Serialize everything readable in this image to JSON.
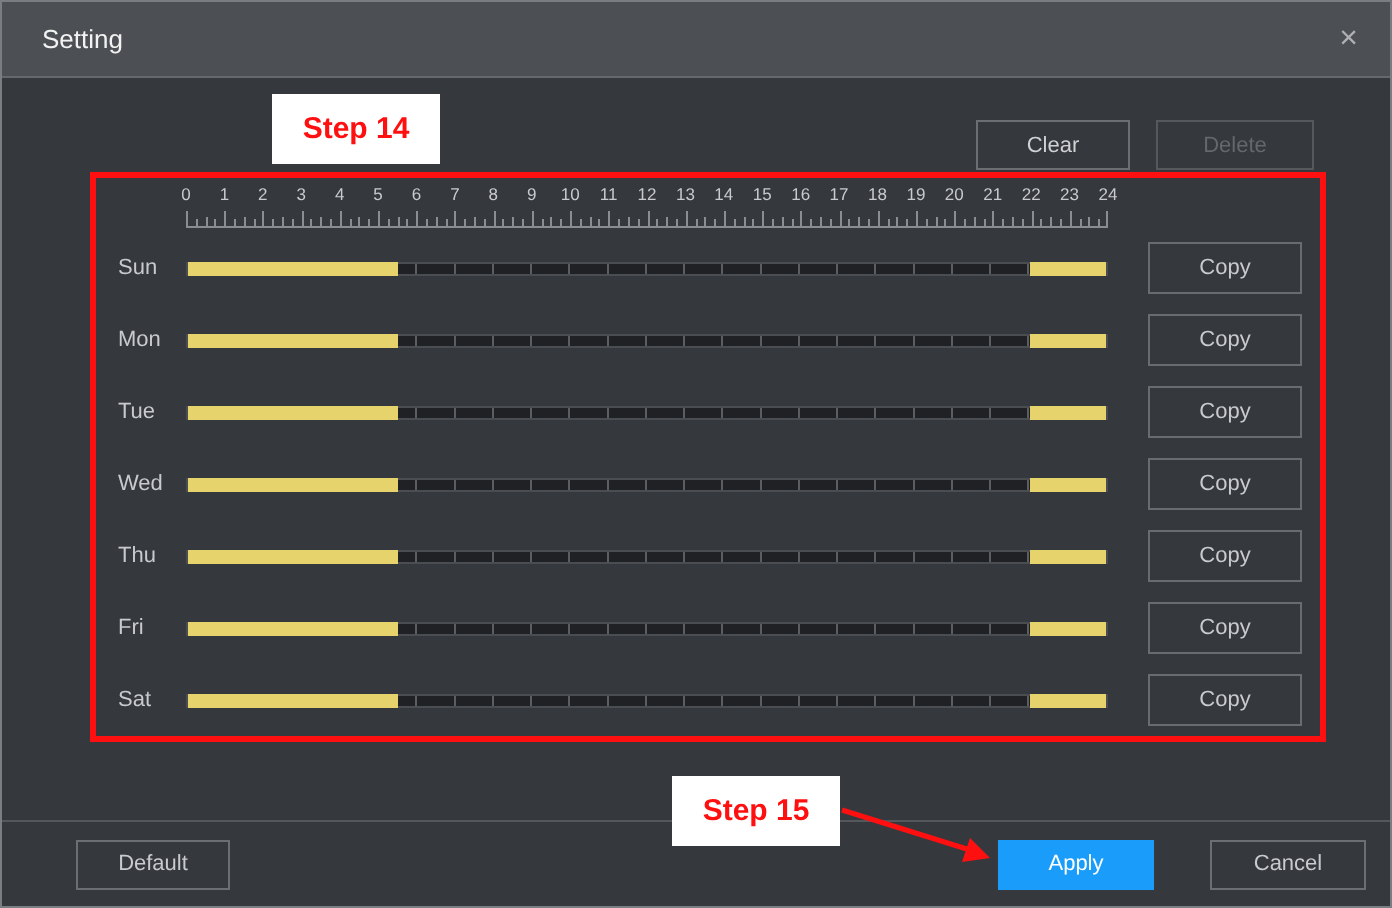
{
  "window": {
    "title": "Setting",
    "close": "×"
  },
  "toolbar": [
    {
      "label": "Clear",
      "disabled": false
    },
    {
      "label": "Delete",
      "disabled": true
    }
  ],
  "schedule": {
    "hours": [
      "0",
      "1",
      "2",
      "3",
      "4",
      "5",
      "6",
      "7",
      "8",
      "9",
      "10",
      "11",
      "12",
      "13",
      "14",
      "15",
      "16",
      "17",
      "18",
      "19",
      "20",
      "21",
      "22",
      "23",
      "24"
    ],
    "days": [
      {
        "name": "Sun",
        "periods": [
          {
            "kind": "from_start",
            "level": 0.229
          },
          {
            "kind": "to_end",
            "level": 0.083
          }
        ],
        "copy": "Copy"
      },
      {
        "name": "Mon",
        "periods": [
          {
            "kind": "from_start",
            "level": 0.229
          },
          {
            "kind": "to_end",
            "level": 0.083
          }
        ],
        "copy": "Copy"
      },
      {
        "name": "Tue",
        "periods": [
          {
            "kind": "from_start",
            "level": 0.229
          },
          {
            "kind": "to_end",
            "level": 0.083
          }
        ],
        "copy": "Copy"
      },
      {
        "name": "Wed",
        "periods": [
          {
            "kind": "from_start",
            "level": 0.229
          },
          {
            "kind": "to_end",
            "level": 0.083
          }
        ],
        "copy": "Copy"
      },
      {
        "name": "Thu",
        "periods": [
          {
            "kind": "from_start",
            "level": 0.229
          },
          {
            "kind": "to_end",
            "level": 0.083
          }
        ],
        "copy": "Copy"
      },
      {
        "name": "Fri",
        "periods": [
          {
            "kind": "from_start",
            "level": 0.229
          },
          {
            "kind": "to_end",
            "level": 0.083
          }
        ],
        "copy": "Copy"
      },
      {
        "name": "Sat",
        "periods": [
          {
            "kind": "from_start",
            "level": 0.229
          },
          {
            "kind": "to_end",
            "level": 0.083
          }
        ],
        "copy": "Copy"
      }
    ]
  },
  "footer": {
    "default": "Default",
    "apply": "Apply",
    "cancel": "Cancel"
  },
  "annotations": [
    {
      "kind": "label",
      "text": "Step 14"
    },
    {
      "kind": "frame"
    },
    {
      "kind": "label",
      "text": "Step 15"
    },
    {
      "kind": "arrow"
    }
  ]
}
